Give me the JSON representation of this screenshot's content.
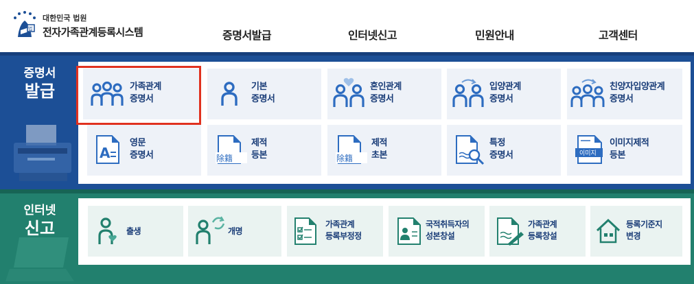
{
  "header": {
    "logo_subtitle": "대한민국 법원",
    "logo_title": "전자가족관계등록시스템",
    "nav": [
      "증명서발급",
      "인터넷신고",
      "민원안내",
      "고객센터"
    ]
  },
  "certificates": {
    "title_line1": "증명서",
    "title_line2": "발급",
    "items": [
      {
        "line1": "가족관계",
        "line2": "증명서",
        "icon": "family-icon"
      },
      {
        "line1": "기본",
        "line2": "증명서",
        "icon": "person-icon"
      },
      {
        "line1": "혼인관계",
        "line2": "증명서",
        "icon": "couple-heart-icon"
      },
      {
        "line1": "입양관계",
        "line2": "증명서",
        "icon": "adoption-icon"
      },
      {
        "line1": "친양자입양관계",
        "line2": "증명서",
        "icon": "full-adoption-icon"
      },
      {
        "line1": "영문",
        "line2": "증명서",
        "icon": "english-document-icon"
      },
      {
        "line1": "제적",
        "line2": "등본",
        "icon": "removed-register-icon"
      },
      {
        "line1": "제적",
        "line2": "초본",
        "icon": "removed-register-icon"
      },
      {
        "line1": "특정",
        "line2": "증명서",
        "icon": "document-search-icon"
      },
      {
        "line1": "이미지제적",
        "line2": "등본",
        "icon": "image-register-icon"
      }
    ],
    "doc_glyph": "除籍",
    "image_badge": "이미지",
    "english_glyph": "A"
  },
  "internet": {
    "title_line1": "인터넷",
    "title_line2": "신고",
    "items": [
      {
        "line1": "출생",
        "line2": "",
        "icon": "birth-icon"
      },
      {
        "line1": "개명",
        "line2": "",
        "icon": "rename-icon"
      },
      {
        "line1": "가족관계",
        "line2": "등록부정정",
        "icon": "checklist-icon"
      },
      {
        "line1": "국적취득자의",
        "line2": "성본창설",
        "icon": "id-card-icon"
      },
      {
        "line1": "가족관계",
        "line2": "등록창설",
        "icon": "document-pen-icon"
      },
      {
        "line1": "등록기준지",
        "line2": "변경",
        "icon": "house-icon"
      }
    ]
  },
  "colors": {
    "blue_band": "#1c4f96",
    "green_band": "#22806e",
    "icon_blue": "#2d6cc0",
    "icon_green": "#22806e",
    "highlight": "#e0311f"
  }
}
